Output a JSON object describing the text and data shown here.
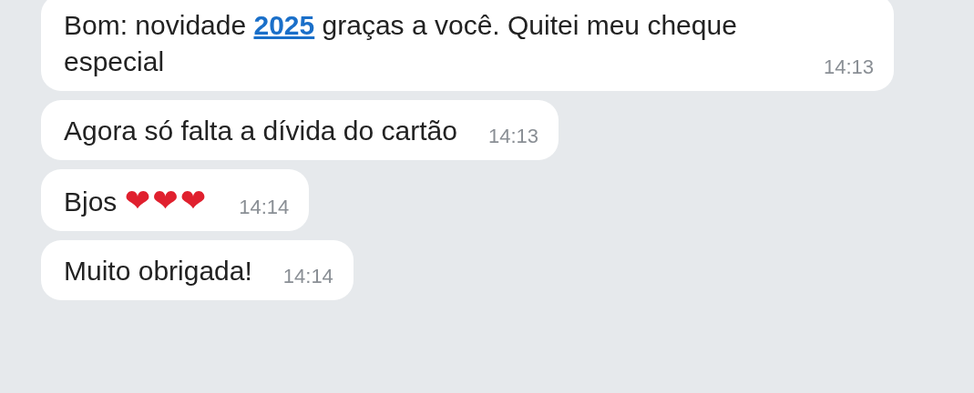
{
  "messages": [
    {
      "parts": [
        {
          "kind": "text",
          "text": "Bom: novidade "
        },
        {
          "kind": "link",
          "text": "2025"
        },
        {
          "kind": "text",
          "text": " graças a você. Quitei meu cheque especial"
        }
      ],
      "time": "14:13"
    },
    {
      "parts": [
        {
          "kind": "text",
          "text": "Agora só falta a dívida do cartão"
        }
      ],
      "time": "14:13"
    },
    {
      "parts": [
        {
          "kind": "text",
          "text": "Bjos "
        },
        {
          "kind": "emoji",
          "text": "❤❤❤"
        }
      ],
      "time": "14:14"
    },
    {
      "parts": [
        {
          "kind": "text",
          "text": "Muito obrigada!"
        }
      ],
      "time": "14:14"
    }
  ]
}
